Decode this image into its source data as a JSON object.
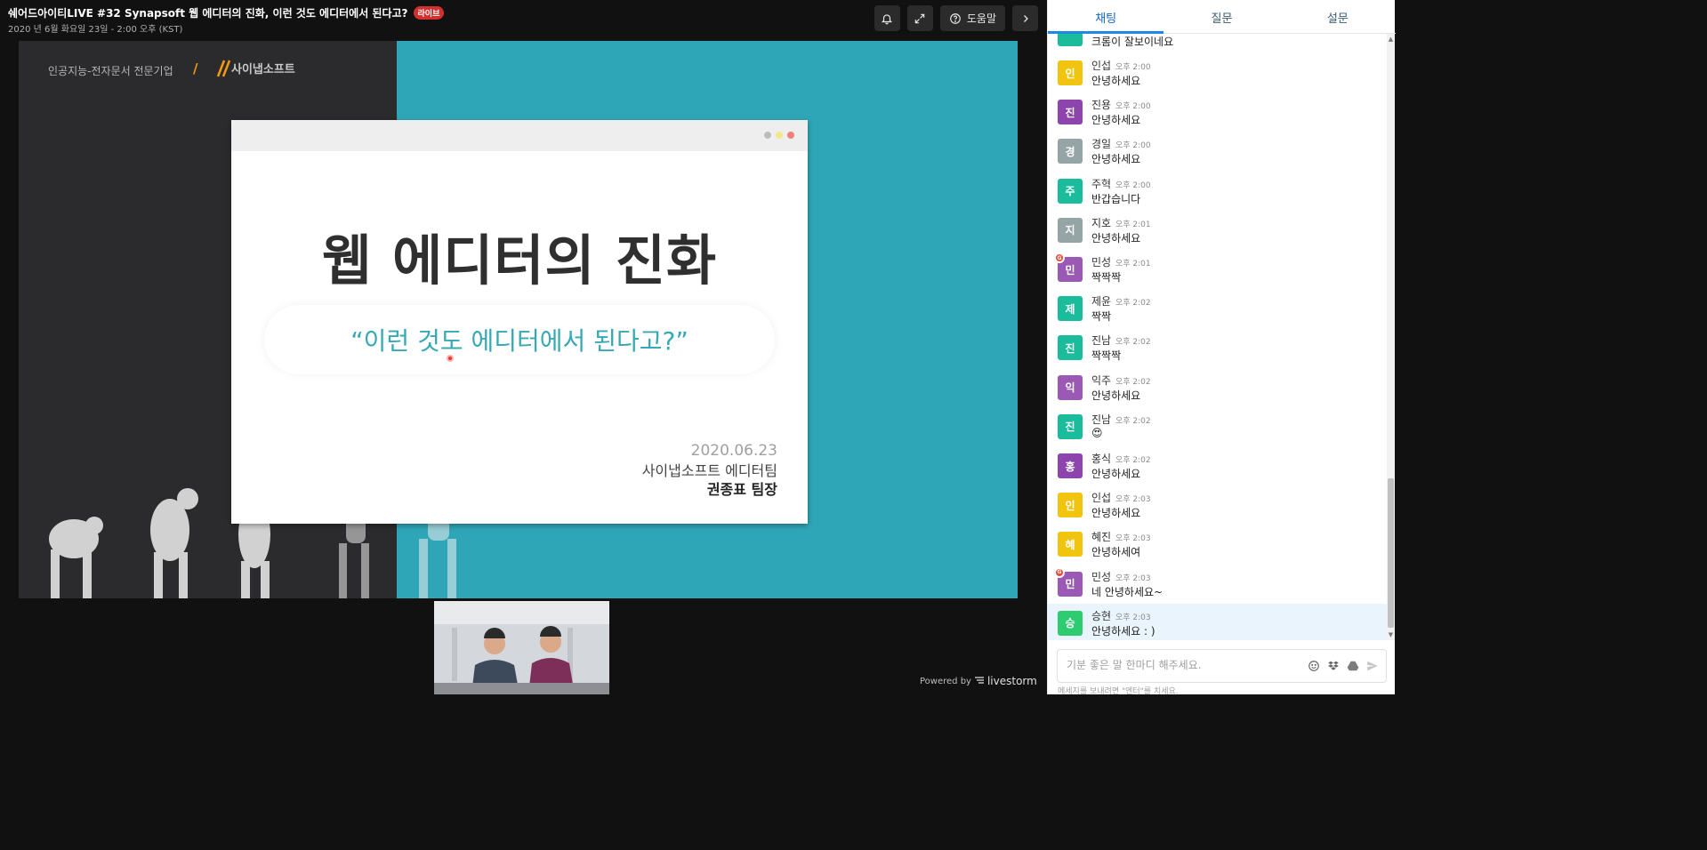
{
  "event": {
    "title": "쉐어드아이티LIVE #32 Synapsoft 웹 에디터의 진화, 이런 것도 에디터에서 된다고?",
    "live_badge": "라이브",
    "date": "2020 년 6월 화요일 23일 - 2:00 오후 (KST)"
  },
  "toolbar": {
    "help_label": "도움말",
    "icons": [
      "bell-icon",
      "expand-icon",
      "help-icon",
      "chevron-right-icon"
    ]
  },
  "slide": {
    "corp_text": "인공지능-전자문서 전문기업",
    "corp_slash": "/",
    "logo_text": "사이냅소프트",
    "title": "웹 에디터의 진화",
    "subtitle": "“이런 것도 에디터에서 된다고?”",
    "date": "2020.06.23",
    "team": "사이냅소프트 에디터팀",
    "presenter": "권종표 팀장"
  },
  "footer": {
    "powered_by": "Powered by",
    "brand": "livestorm"
  },
  "panel": {
    "tabs": [
      {
        "label": "채팅",
        "active": true
      },
      {
        "label": "질문",
        "active": false
      },
      {
        "label": "설문",
        "active": false
      }
    ],
    "partial_top_text": "크롬이 잘보이네요",
    "messages": [
      {
        "initial": "인",
        "name": "인섭",
        "time": "오후 2:00",
        "text": "안녕하세요",
        "color": "#f1c40f"
      },
      {
        "initial": "진",
        "name": "진용",
        "time": "오후 2:00",
        "text": "안녕하세요",
        "color": "#8e44ad"
      },
      {
        "initial": "경",
        "name": "경일",
        "time": "오후 2:00",
        "text": "안녕하세요",
        "color": "#95a5a6"
      },
      {
        "initial": "주",
        "name": "주혁",
        "time": "오후 2:00",
        "text": "반갑습니다",
        "color": "#1abc9c"
      },
      {
        "initial": "지",
        "name": "지호",
        "time": "오후 2:01",
        "text": "안녕하세요",
        "color": "#95a5a6"
      },
      {
        "initial": "민",
        "name": "민성",
        "time": "오후 2:01",
        "text": "짝짝짝",
        "color": "#9b59b6",
        "badge": "G"
      },
      {
        "initial": "제",
        "name": "제윤",
        "time": "오후 2:02",
        "text": "짝짝",
        "color": "#1abc9c"
      },
      {
        "initial": "진",
        "name": "진남",
        "time": "오후 2:02",
        "text": "짝짝짝",
        "color": "#1abc9c"
      },
      {
        "initial": "익",
        "name": "익주",
        "time": "오후 2:02",
        "text": "안녕하세요",
        "color": "#9b59b6"
      },
      {
        "initial": "진",
        "name": "진남",
        "time": "오후 2:02",
        "text": "😍",
        "color": "#1abc9c"
      },
      {
        "initial": "홍",
        "name": "홍식",
        "time": "오후 2:02",
        "text": "안녕하세요",
        "color": "#8e44ad"
      },
      {
        "initial": "인",
        "name": "인섭",
        "time": "오후 2:03",
        "text": "안녕하세요",
        "color": "#f1c40f"
      },
      {
        "initial": "혜",
        "name": "혜진",
        "time": "오후 2:03",
        "text": "안녕하세여",
        "color": "#f1c40f"
      },
      {
        "initial": "민",
        "name": "민성",
        "time": "오후 2:03",
        "text": "네 안녕하세요~",
        "color": "#9b59b6",
        "badge": "G"
      },
      {
        "initial": "승",
        "name": "승현",
        "time": "오후 2:03",
        "text": "안녕하세요 : )",
        "color": "#2ecc71",
        "highlight": true
      }
    ],
    "input_placeholder": "기분 좋은 말 한마디 해주세요.",
    "input_hint": "메세지를 보내려면 \"엔터\"를 치세요.",
    "input_icons": [
      "emoji-icon",
      "dropbox-icon",
      "google-drive-icon",
      "send-icon"
    ]
  },
  "colors": {
    "accent": "#1e88e5",
    "slide_teal": "#2fa6b7",
    "live_red": "#d32f2f"
  }
}
